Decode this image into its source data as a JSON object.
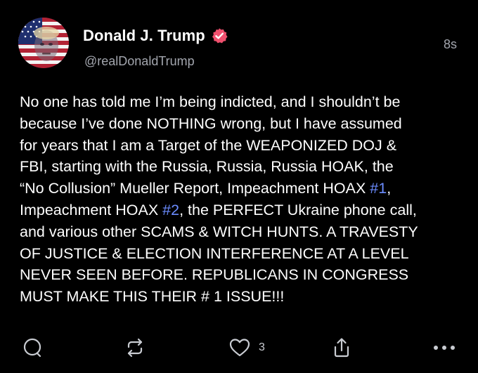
{
  "post": {
    "author": {
      "display_name": "Donald J. Trump",
      "handle": "@realDonaldTrump",
      "verified_icon": "verified-badge-icon",
      "avatar_icon": "profile-avatar"
    },
    "timestamp": "8s",
    "body": {
      "line1": "No one has told me I’m being indicted, and I shouldn’t be",
      "line2": "because I’ve done NOTHING wrong, but I have assumed",
      "line3": "for years that I am a Target of the WEAPONIZED DOJ &",
      "line4": "FBI, starting with the Russia, Russia, Russia HOAK, the",
      "line5_a": "“No Collusion” Mueller Report, Impeachment HOAX ",
      "line5_tag": "#1",
      "line5_b": ",",
      "line6_a": "Impeachment HOAX ",
      "line6_tag": "#2",
      "line6_b": ", the PERFECT Ukraine phone call,",
      "line7": "and various other SCAMS & WITCH HUNTS. A TRAVESTY",
      "line8": "OF JUSTICE & ELECTION INTERFERENCE AT A LEVEL",
      "line9": "NEVER SEEN BEFORE. REPUBLICANS IN CONGRESS",
      "line10": "MUST MAKE THIS THEIR # 1 ISSUE!!!"
    },
    "actions": {
      "like_count": "3",
      "icons": [
        "reply-icon",
        "repost-icon",
        "heart-icon",
        "share-icon",
        "more-icon"
      ]
    }
  },
  "colors": {
    "background": "#000000",
    "text": "#ffffff",
    "secondary": "#a3a6ae",
    "hashtag": "#6b8cff",
    "verified": "#f0506e",
    "icon": "#c9ccd2"
  }
}
